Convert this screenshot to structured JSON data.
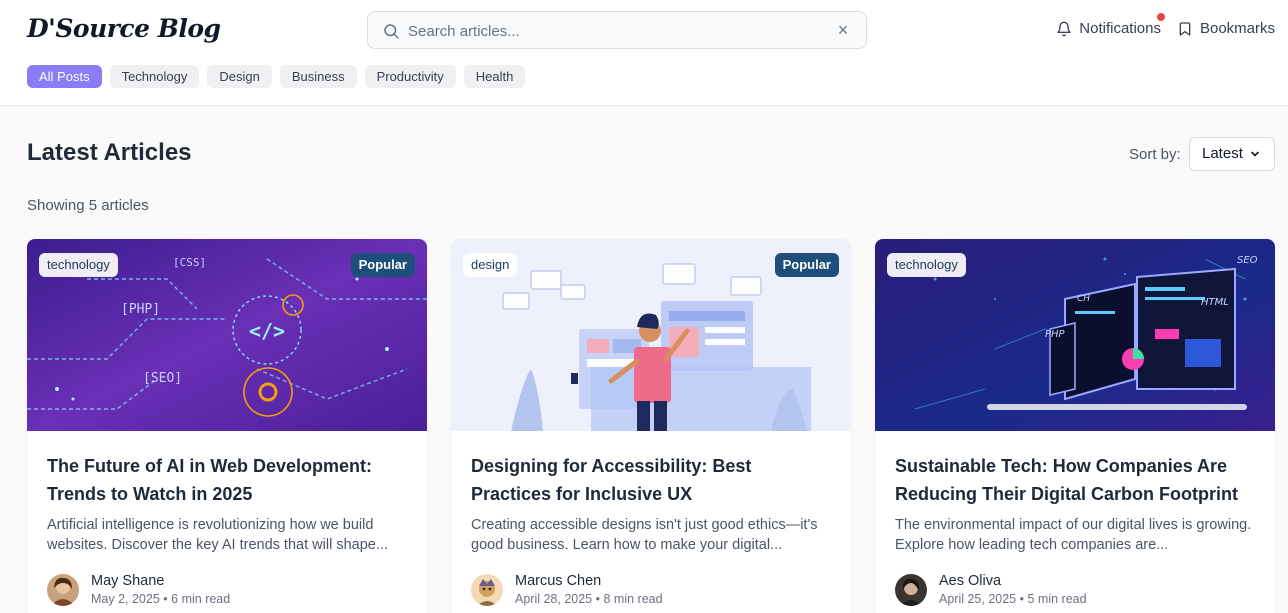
{
  "header": {
    "logo": "D'Source Blog",
    "search_placeholder": "Search articles...",
    "notifications_label": "Notifications",
    "bookmarks_label": "Bookmarks"
  },
  "categories": [
    "All Posts",
    "Technology",
    "Design",
    "Business",
    "Productivity",
    "Health"
  ],
  "main": {
    "title": "Latest Articles",
    "sort_label": "Sort by:",
    "sort_value": "Latest",
    "showing_text": "Showing 5 articles"
  },
  "articles": [
    {
      "tag": "technology",
      "badge": "Popular",
      "title": "The Future of AI in Web Development: Trends to Watch in 2025",
      "excerpt": "Artificial intelligence is revolutionizing how we build websites. Discover the key AI trends that will shape...",
      "author": "May Shane",
      "date": "May 2, 2025",
      "read_time": "6 min read"
    },
    {
      "tag": "design",
      "badge": "Popular",
      "title": "Designing for Accessibility: Best Practices for Inclusive UX",
      "excerpt": "Creating accessible designs isn't just good ethics—it's good business. Learn how to make your digital...",
      "author": "Marcus Chen",
      "date": "April 28, 2025",
      "read_time": "8 min read"
    },
    {
      "tag": "technology",
      "badge": "",
      "title": "Sustainable Tech: How Companies Are Reducing Their Digital Carbon Footprint",
      "excerpt": "The environmental impact of our digital lives is growing. Explore how leading tech companies are...",
      "author": "Aes Oliva",
      "date": "April 25, 2025",
      "read_time": "5 min read"
    }
  ],
  "meta_separator": "•",
  "illustration_text": {
    "card1": [
      "[PHP]",
      "[SEO]",
      "[CSS]",
      "</>"
    ],
    "card3": [
      "PHP",
      "HTML",
      "SEO",
      "CH"
    ]
  },
  "colors": {
    "accent": "#8b7cf6",
    "badge": "#1e4e79",
    "notification_dot": "#ef4444"
  }
}
